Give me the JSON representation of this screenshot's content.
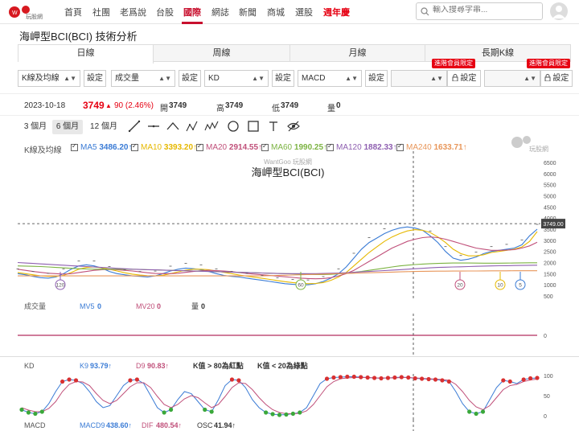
{
  "nav": {
    "logo_text": "玩股網",
    "items": [
      "首頁",
      "社團",
      "老爲說",
      "台股",
      "國際",
      "網誌",
      "新聞",
      "商城",
      "選股",
      "週年慶"
    ],
    "active_index": 4,
    "search_placeholder": "輸入搜尋字串..."
  },
  "page": {
    "title": "海岬型BCI(BCI) 技術分析"
  },
  "tabs": [
    "日線",
    "周線",
    "月線",
    "長期K線"
  ],
  "active_tab": 0,
  "controls": {
    "selects": [
      "K線及均線",
      "成交量",
      "KD",
      "MACD",
      "",
      ""
    ],
    "setting_label": "設定",
    "vip_label": "進階會員限定"
  },
  "quote": {
    "date": "2023-10-18",
    "price": "3749",
    "change": "90 (2.46%)",
    "open_label": "開",
    "open": "3749",
    "high_label": "高",
    "high": "3749",
    "low_label": "低",
    "low": "3749",
    "vol_label": "量",
    "vol": "0"
  },
  "ranges": [
    "3 個月",
    "6 個月",
    "12 個月"
  ],
  "active_range": 1,
  "colors": {
    "up": "#e60012",
    "ma5": "#3a7bd5",
    "ma10": "#e6b800",
    "ma20": "#c0507a",
    "ma60": "#7cb342",
    "ma120": "#8e5fb0",
    "ma240": "#e8965a",
    "kd_k": "#3a7bd5",
    "kd_d": "#c0507a",
    "red_dot": "#d93030",
    "green_dot": "#3aa83a"
  },
  "legend": {
    "kline_label": "K線及均線",
    "ma": [
      {
        "label": "MA5",
        "value": "3486.20↑"
      },
      {
        "label": "MA10",
        "value": "3393.20↑"
      },
      {
        "label": "MA20",
        "value": "2914.55↑"
      },
      {
        "label": "MA60",
        "value": "1990.25↑"
      },
      {
        "label": "MA120",
        "value": "1882.33↑"
      },
      {
        "label": "MA240",
        "value": "1633.71↑"
      }
    ]
  },
  "chart_data": [
    {
      "type": "line",
      "title": "海岬型BCI(BCI)",
      "watermark": "WantGoo 玩股網",
      "ylim": [
        500,
        6500
      ],
      "y_ticks": [
        500,
        1000,
        1500,
        2000,
        2500,
        3000,
        3500,
        4000,
        4500,
        5000,
        5500,
        6000,
        6500
      ],
      "y_tick_labels": [
        "500",
        "1000",
        "1500",
        "2000",
        "2500",
        "3000",
        "3500",
        "4000",
        "4500",
        "5000",
        "5500",
        "6000",
        "6500"
      ],
      "current_price_label": "3749.00",
      "current_price": 3749,
      "markers": [
        "120",
        "60",
        "20",
        "10",
        "5"
      ],
      "x_index_count": 120,
      "series": [
        {
          "name": "MA5",
          "values": [
            1500,
            1450,
            1380,
            1320,
            1300,
            1350,
            1500,
            1700,
            1850,
            1900,
            1850,
            1750,
            1600,
            1500,
            1450,
            1400,
            1380,
            1350,
            1400,
            1500,
            1620,
            1700,
            1750,
            1720,
            1680,
            1600,
            1500,
            1420,
            1380,
            1350,
            1300,
            1250,
            1200,
            1150,
            1100,
            1050,
            1020,
            1000,
            1000,
            1050,
            1150,
            1300,
            1500,
            1800,
            2200,
            2600,
            2900,
            3100,
            3300,
            3450,
            3550,
            3600,
            3550,
            3450,
            3200,
            2900,
            2500,
            2200,
            2100,
            2150,
            2250,
            2400,
            2500,
            2550,
            2600,
            2650,
            2800,
            3200,
            3500
          ]
        },
        {
          "name": "MA10",
          "values": [
            1550,
            1500,
            1450,
            1400,
            1380,
            1380,
            1420,
            1550,
            1700,
            1780,
            1800,
            1760,
            1700,
            1620,
            1540,
            1480,
            1440,
            1410,
            1400,
            1430,
            1500,
            1580,
            1660,
            1700,
            1700,
            1680,
            1620,
            1560,
            1500,
            1440,
            1390,
            1340,
            1290,
            1240,
            1190,
            1140,
            1100,
            1070,
            1050,
            1060,
            1100,
            1200,
            1350,
            1550,
            1850,
            2150,
            2450,
            2700,
            2950,
            3150,
            3300,
            3420,
            3480,
            3450,
            3350,
            3150,
            2900,
            2600,
            2400,
            2300,
            2300,
            2350,
            2450,
            2500,
            2550,
            2600,
            2700,
            2950,
            3393
          ]
        },
        {
          "name": "MA20",
          "values": [
            1700,
            1650,
            1600,
            1560,
            1520,
            1500,
            1480,
            1500,
            1550,
            1600,
            1650,
            1680,
            1690,
            1680,
            1650,
            1620,
            1580,
            1540,
            1510,
            1500,
            1500,
            1520,
            1560,
            1600,
            1630,
            1650,
            1640,
            1620,
            1590,
            1550,
            1510,
            1480,
            1450,
            1420,
            1390,
            1360,
            1330,
            1300,
            1280,
            1270,
            1280,
            1320,
            1400,
            1500,
            1650,
            1850,
            2050,
            2250,
            2450,
            2650,
            2800,
            2950,
            3050,
            3120,
            3150,
            3120,
            3050,
            2950,
            2850,
            2750,
            2650,
            2600,
            2550,
            2550,
            2560,
            2580,
            2650,
            2750,
            2914
          ]
        },
        {
          "name": "MA60",
          "values": [
            1850,
            1840,
            1830,
            1820,
            1800,
            1780,
            1760,
            1740,
            1720,
            1710,
            1700,
            1700,
            1700,
            1700,
            1700,
            1700,
            1690,
            1680,
            1670,
            1660,
            1650,
            1640,
            1630,
            1620,
            1610,
            1600,
            1590,
            1580,
            1570,
            1560,
            1550,
            1540,
            1530,
            1520,
            1510,
            1500,
            1490,
            1480,
            1470,
            1460,
            1460,
            1470,
            1490,
            1520,
            1560,
            1600,
            1650,
            1700,
            1750,
            1800,
            1850,
            1880,
            1910,
            1930,
            1950,
            1960,
            1970,
            1980,
            1980,
            1980,
            1975,
            1970,
            1970,
            1970,
            1975,
            1980,
            1985,
            1988,
            1990
          ]
        },
        {
          "name": "MA120",
          "values": [
            2000,
            1980,
            1960,
            1940,
            1920,
            1900,
            1880,
            1860,
            1840,
            1820,
            1800,
            1780,
            1760,
            1740,
            1720,
            1700,
            1690,
            1680,
            1670,
            1660,
            1650,
            1640,
            1630,
            1620,
            1610,
            1600,
            1590,
            1580,
            1570,
            1560,
            1550,
            1540,
            1530,
            1520,
            1510,
            1500,
            1500,
            1500,
            1500,
            1500,
            1510,
            1520,
            1530,
            1540,
            1560,
            1580,
            1600,
            1620,
            1640,
            1660,
            1680,
            1700,
            1720,
            1740,
            1760,
            1780,
            1790,
            1800,
            1810,
            1820,
            1830,
            1840,
            1850,
            1855,
            1860,
            1865,
            1870,
            1876,
            1882
          ]
        },
        {
          "name": "MA240",
          "values": [
            1400,
            1400,
            1400,
            1400,
            1400,
            1400,
            1400,
            1400,
            1400,
            1400,
            1400,
            1400,
            1400,
            1400,
            1400,
            1400,
            1400,
            1400,
            1400,
            1400,
            1400,
            1400,
            1400,
            1400,
            1400,
            1400,
            1400,
            1400,
            1400,
            1400,
            1400,
            1400,
            1400,
            1410,
            1420,
            1430,
            1440,
            1450,
            1460,
            1470,
            1480,
            1490,
            1500,
            1510,
            1520,
            1530,
            1540,
            1550,
            1560,
            1570,
            1580,
            1590,
            1600,
            1605,
            1610,
            1612,
            1614,
            1616,
            1618,
            1620,
            1622,
            1624,
            1626,
            1628,
            1629,
            1630,
            1631,
            1632,
            1633
          ]
        }
      ]
    },
    {
      "type": "bar",
      "title": "",
      "legend_label": "成交量",
      "mv5_label": "MV5",
      "mv5": "0",
      "mv20_label": "MV20",
      "mv20": "0",
      "vol_label": "量",
      "vol": "0",
      "y_ticks": [
        0
      ],
      "y_tick_labels": [
        "0"
      ]
    },
    {
      "type": "line",
      "title": "",
      "legend_label": "KD",
      "k_label": "K9",
      "k_value": "93.79↑",
      "d_label": "D9",
      "d_value": "90.83↑",
      "note1": "K值 > 80為紅點",
      "note2": "K值 < 20為綠點",
      "ylim": [
        0,
        100
      ],
      "y_ticks": [
        0,
        50,
        100
      ],
      "y_tick_labels": [
        "0",
        "50",
        "100"
      ],
      "series": [
        {
          "name": "K9",
          "values": [
            15,
            8,
            5,
            10,
            30,
            60,
            85,
            90,
            88,
            80,
            60,
            35,
            20,
            25,
            50,
            75,
            88,
            90,
            80,
            50,
            20,
            8,
            15,
            40,
            60,
            55,
            35,
            15,
            10,
            40,
            75,
            90,
            88,
            70,
            40,
            20,
            8,
            4,
            2,
            3,
            5,
            8,
            20,
            50,
            80,
            92,
            95,
            96,
            97,
            97,
            96,
            95,
            94,
            93,
            94,
            95,
            96,
            95,
            93,
            92,
            91,
            90,
            88,
            85,
            60,
            30,
            10,
            5,
            10,
            40,
            70,
            88,
            85,
            80,
            90,
            93,
            94
          ]
        },
        {
          "name": "D9",
          "values": [
            20,
            14,
            10,
            10,
            18,
            35,
            60,
            78,
            85,
            84,
            75,
            55,
            38,
            30,
            38,
            55,
            72,
            82,
            82,
            70,
            48,
            28,
            20,
            28,
            42,
            50,
            45,
            32,
            20,
            28,
            48,
            70,
            82,
            80,
            65,
            45,
            28,
            15,
            8,
            5,
            5,
            6,
            12,
            28,
            50,
            72,
            85,
            92,
            94,
            95,
            95,
            95,
            94,
            94,
            94,
            94,
            95,
            95,
            94,
            93,
            92,
            91,
            90,
            88,
            78,
            60,
            38,
            22,
            15,
            25,
            45,
            65,
            75,
            78,
            85,
            89,
            91
          ]
        }
      ]
    },
    {
      "type": "bar",
      "title": "",
      "legend_label": "MACD",
      "macd_label": "MACD9",
      "macd_value": "438.60↑",
      "dif_label": "DIF",
      "dif_value": "480.54↑",
      "osc_label": "OSC",
      "osc_value": "41.94↑"
    }
  ]
}
